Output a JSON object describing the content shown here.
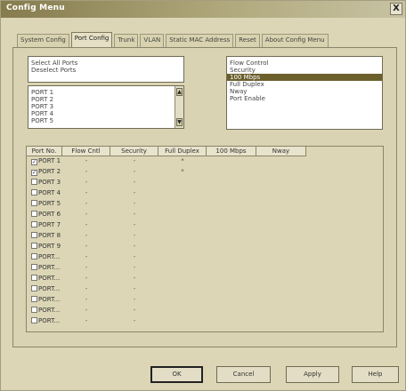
{
  "window": {
    "title": "Config Menu",
    "close_label": "X"
  },
  "tabs": [
    {
      "label": "System Config",
      "active": false
    },
    {
      "label": "Port Config",
      "active": true
    },
    {
      "label": "Trunk",
      "active": false
    },
    {
      "label": "VLAN",
      "active": false
    },
    {
      "label": "Static MAC Address",
      "active": false
    },
    {
      "label": "Reset",
      "active": false
    },
    {
      "label": "About Config Menu",
      "active": false
    }
  ],
  "select_list": {
    "items": [
      "Select All Ports",
      "Deselect Ports"
    ]
  },
  "port_list": {
    "items": [
      "PORT 1",
      "PORT 2",
      "PORT 3",
      "PORT 4",
      "PORT 5"
    ]
  },
  "options_list": {
    "items": [
      "Flow Control",
      "Security",
      "100 Mbps",
      "Full Duplex",
      "Nway",
      "Port Enable"
    ],
    "selected_index": 2
  },
  "grid": {
    "headers": [
      "Port No.",
      "Flow Cntl",
      "Security",
      "Full Duplex",
      "100 Mbps",
      "Nway"
    ],
    "rows": [
      {
        "port": "PORT 1",
        "checked": true,
        "flow": "-",
        "security": "-",
        "duplex": "*",
        "speed": "",
        "nway": ""
      },
      {
        "port": "PORT 2",
        "checked": true,
        "flow": "-",
        "security": "-",
        "duplex": "*",
        "speed": "",
        "nway": ""
      },
      {
        "port": "PORT 3",
        "checked": false,
        "flow": "-",
        "security": "-",
        "duplex": "",
        "speed": "",
        "nway": ""
      },
      {
        "port": "PORT 4",
        "checked": false,
        "flow": "-",
        "security": "-",
        "duplex": "",
        "speed": "",
        "nway": ""
      },
      {
        "port": "PORT 5",
        "checked": false,
        "flow": "-",
        "security": "-",
        "duplex": "",
        "speed": "",
        "nway": ""
      },
      {
        "port": "PORT 6",
        "checked": false,
        "flow": "-",
        "security": "-",
        "duplex": "",
        "speed": "",
        "nway": ""
      },
      {
        "port": "PORT 7",
        "checked": false,
        "flow": "-",
        "security": "-",
        "duplex": "",
        "speed": "",
        "nway": ""
      },
      {
        "port": "PORT 8",
        "checked": false,
        "flow": "-",
        "security": "-",
        "duplex": "",
        "speed": "",
        "nway": ""
      },
      {
        "port": "PORT 9",
        "checked": false,
        "flow": "-",
        "security": "-",
        "duplex": "",
        "speed": "",
        "nway": ""
      },
      {
        "port": "PORT...",
        "checked": false,
        "flow": "-",
        "security": "-",
        "duplex": "",
        "speed": "",
        "nway": ""
      },
      {
        "port": "PORT...",
        "checked": false,
        "flow": "-",
        "security": "-",
        "duplex": "",
        "speed": "",
        "nway": ""
      },
      {
        "port": "PORT...",
        "checked": false,
        "flow": "-",
        "security": "-",
        "duplex": "",
        "speed": "",
        "nway": ""
      },
      {
        "port": "PORT...",
        "checked": false,
        "flow": "-",
        "security": "-",
        "duplex": "",
        "speed": "",
        "nway": ""
      },
      {
        "port": "PORT...",
        "checked": false,
        "flow": "-",
        "security": "-",
        "duplex": "",
        "speed": "",
        "nway": ""
      },
      {
        "port": "PORT...",
        "checked": false,
        "flow": "-",
        "security": "-",
        "duplex": "",
        "speed": "",
        "nway": ""
      },
      {
        "port": "PORT...",
        "checked": false,
        "flow": "-",
        "security": "-",
        "duplex": "",
        "speed": "",
        "nway": ""
      }
    ]
  },
  "buttons": {
    "ok": "OK",
    "cancel": "Cancel",
    "apply": "Apply",
    "help": "Help"
  },
  "icons": {
    "close": "close-icon",
    "scroll_up": "arrow-up-icon",
    "scroll_down": "arrow-down-icon",
    "check": "checkmark-icon"
  },
  "colors": {
    "selection": "#6b5f2c",
    "window_bg": "#dcd6b6",
    "titlebar": "#857b4d"
  }
}
